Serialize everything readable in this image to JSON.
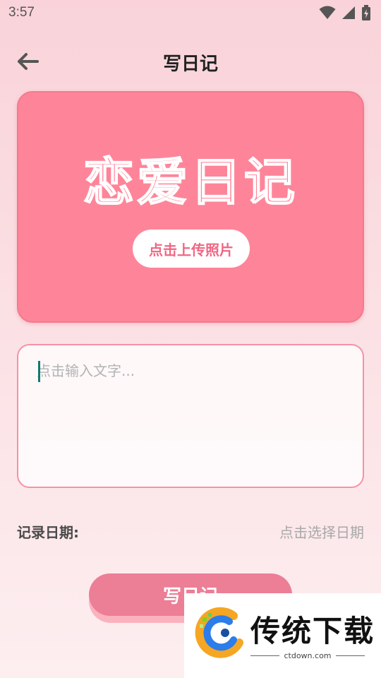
{
  "status_bar": {
    "time": "3:57",
    "icons": [
      "wifi-icon",
      "signal-icon",
      "battery-icon"
    ]
  },
  "appbar": {
    "back_icon": "arrow-left-icon",
    "title": "写日记"
  },
  "photo_card": {
    "title": "恋爱日记",
    "upload_label": "点击上传照片"
  },
  "editor": {
    "placeholder": "点击输入文字...",
    "value": ""
  },
  "date_row": {
    "label": "记录日期:",
    "picker_text": "点击选择日期"
  },
  "submit": {
    "label": "写日记"
  },
  "watermark": {
    "brand": "传统下载",
    "domain": "ctdown.com"
  },
  "colors": {
    "card_bg": "#fe8599",
    "accent": "#f06683",
    "button_bg": "#ec7e96",
    "border": "#f493a6"
  }
}
